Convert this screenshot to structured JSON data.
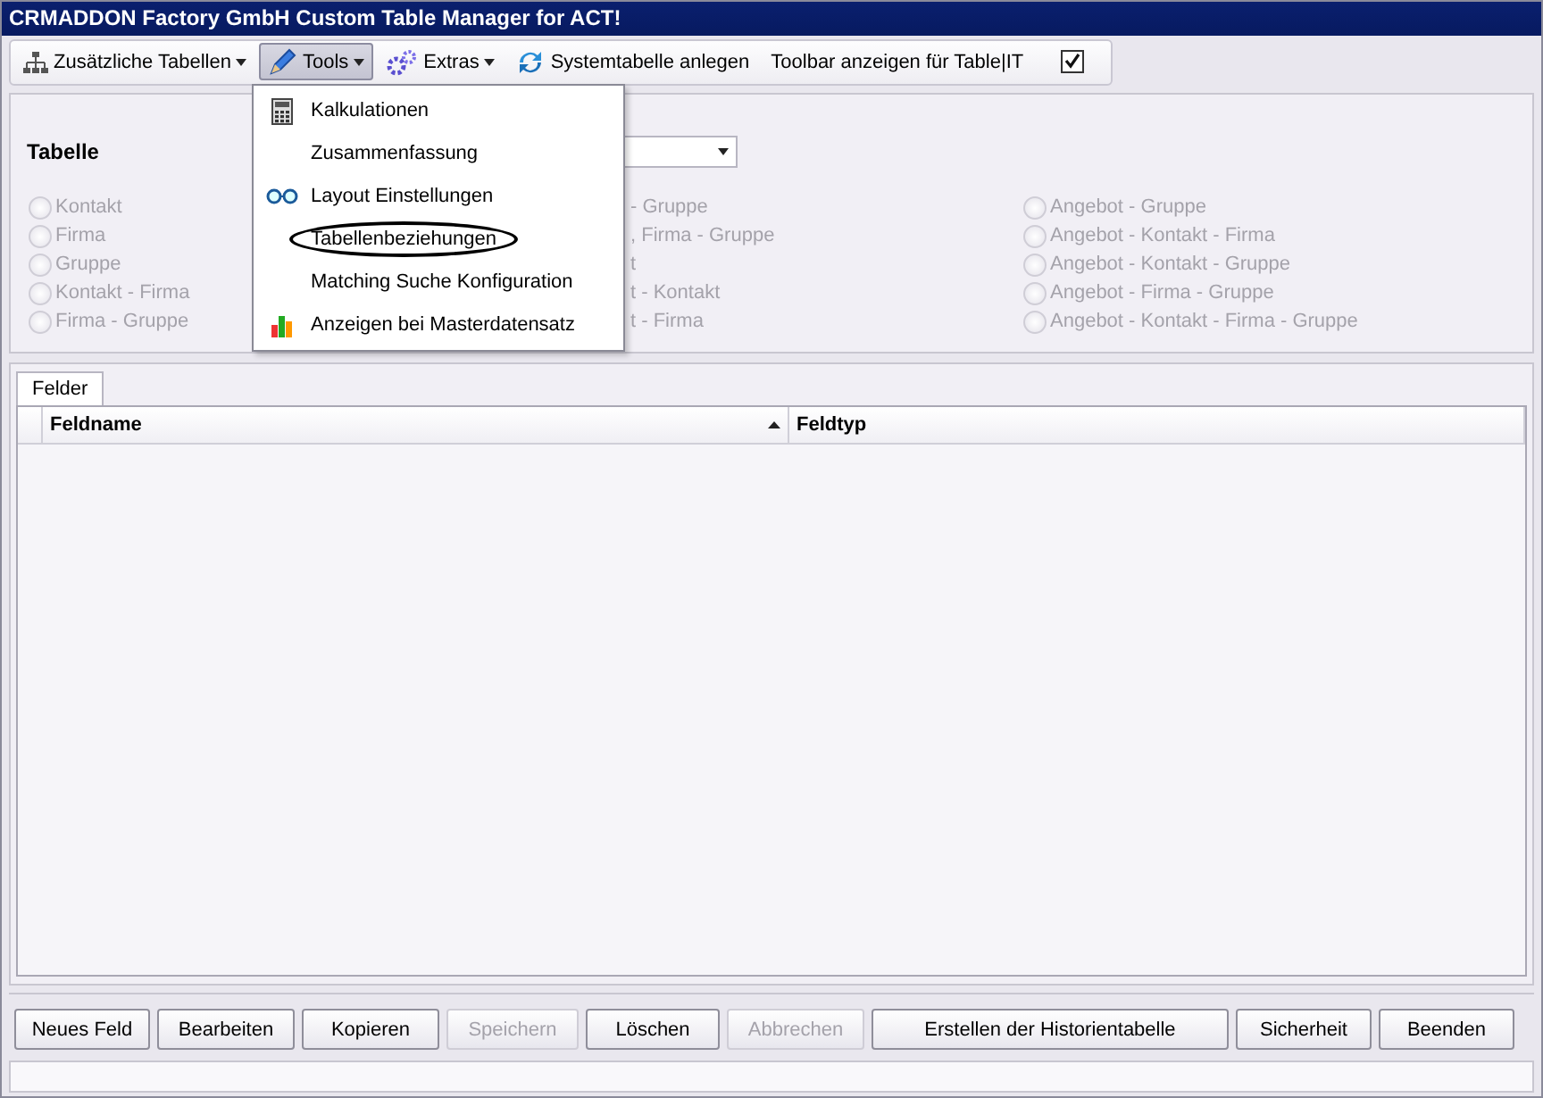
{
  "window": {
    "title": "CRMADDON Factory GmbH Custom Table Manager for ACT!"
  },
  "toolbar": [
    {
      "kind": "button",
      "label": "Zusätzliche Tabellen",
      "dropdown": true,
      "pressed": false
    },
    {
      "kind": "button",
      "label": "Tools",
      "dropdown": true,
      "pressed": true
    },
    {
      "kind": "button",
      "label": "Extras",
      "dropdown": true,
      "pressed": false
    },
    {
      "kind": "button",
      "label": "Systemtabelle anlegen",
      "dropdown": false,
      "pressed": false
    },
    {
      "kind": "button",
      "label": "Toolbar anzeigen für Table|IT",
      "dropdown": false,
      "pressed": false
    },
    {
      "kind": "checkbox",
      "checked": true
    }
  ],
  "menu": [
    {
      "label": "Kalkulationen",
      "circled": false
    },
    {
      "label": "Zusammenfassung",
      "circled": false
    },
    {
      "label": "Layout Einstellungen",
      "circled": false
    },
    {
      "label": "Tabellenbeziehungen",
      "circled": true
    },
    {
      "label": "Matching Suche Konfiguration",
      "circled": false
    },
    {
      "label": "Anzeigen bei Masterdatensatz",
      "circled": false
    }
  ],
  "table_section": {
    "label": "Tabelle",
    "disabled": true,
    "column_1": [
      "Kontakt",
      "Firma",
      "Gruppe",
      "Kontakt - Firma",
      "Firma - Gruppe"
    ],
    "column_2": [
      "- Gruppe",
      ", Firma - Gruppe",
      "t",
      "t - Kontakt",
      "t - Firma"
    ],
    "column_3": [
      "Angebot - Gruppe",
      "Angebot - Kontakt - Firma",
      "Angebot - Kontakt - Gruppe",
      "Angebot - Firma - Gruppe",
      "Angebot - Kontakt - Firma - Gruppe"
    ]
  },
  "tabs": [
    {
      "label": "Felder",
      "selected": true
    }
  ],
  "grid": {
    "columns": [
      {
        "label": "Feldname",
        "sorted": true
      },
      {
        "label": "Feldtyp",
        "sorted": false
      }
    ]
  },
  "buttons": [
    {
      "label": "Neues Feld",
      "disabled": false
    },
    {
      "label": "Bearbeiten",
      "disabled": false
    },
    {
      "label": "Kopieren",
      "disabled": false
    },
    {
      "label": "Speichern",
      "disabled": true
    },
    {
      "label": "Löschen",
      "disabled": false
    },
    {
      "label": "Abbrechen",
      "disabled": true
    },
    {
      "label": "Erstellen der Historientabelle",
      "disabled": false
    },
    {
      "label": "Sicherheit",
      "disabled": false
    },
    {
      "label": "Beenden",
      "disabled": false
    }
  ]
}
